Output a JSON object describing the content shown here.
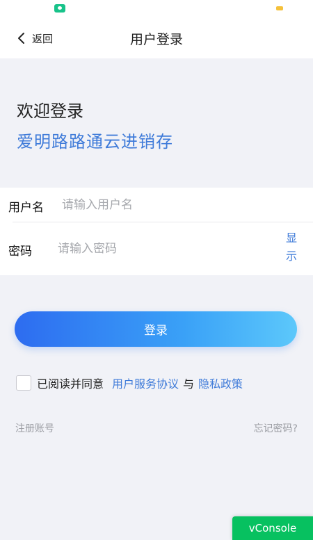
{
  "nav": {
    "back_label": "返回",
    "title": "用户登录"
  },
  "welcome": {
    "title": "欢迎登录",
    "app_name": "爱明路路通云进销存"
  },
  "form": {
    "username": {
      "label": "用户名",
      "value": "",
      "placeholder": "请输入用户名"
    },
    "password": {
      "label": "密码",
      "value": "",
      "placeholder": "请输入密码",
      "show_toggle": "显示"
    }
  },
  "login_button": "登录",
  "agreement": {
    "text": "已阅读并同意",
    "terms_link": "用户服务协议",
    "and": "与",
    "privacy_link": "隐私政策"
  },
  "links": {
    "register": "注册账号",
    "forgot": "忘记密码?"
  },
  "vconsole": "vConsole",
  "colors": {
    "accent": "#3f7bd9",
    "background": "#f1f2f7",
    "vconsole": "#07c160"
  },
  "icons": {
    "back": "chevron-left-icon"
  }
}
